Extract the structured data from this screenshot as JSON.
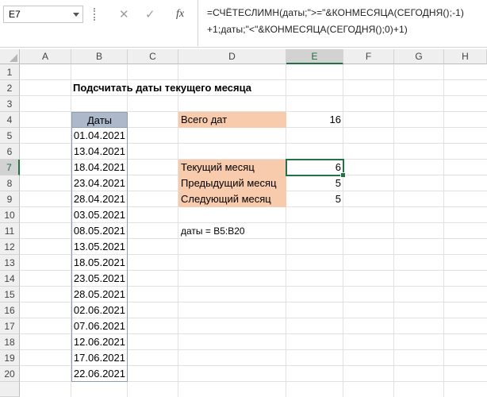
{
  "namebox": {
    "value": "E7"
  },
  "formula_bar": {
    "cancel_icon": "✕",
    "enter_icon": "✓",
    "fx_label": "fx",
    "formula": "=СЧЁТЕСЛИМН(даты;\">=\"&КОНМЕСЯЦА(СЕГОДНЯ();-1)\n+1;даты;\"<\"&КОНМЕСЯЦА(СЕГОДНЯ();0)+1)"
  },
  "columns": [
    "A",
    "B",
    "C",
    "D",
    "E",
    "F",
    "G",
    "H"
  ],
  "rows": [
    "1",
    "2",
    "3",
    "4",
    "5",
    "6",
    "7",
    "8",
    "9",
    "10",
    "11",
    "12",
    "13",
    "14",
    "15",
    "16",
    "17",
    "18",
    "19",
    "20"
  ],
  "selected": {
    "column": "E",
    "row": "7"
  },
  "sheet": {
    "title": "Подсчитать даты текущего месяца",
    "dates_header": "Даты",
    "dates": [
      "01.04.2021",
      "13.04.2021",
      "18.04.2021",
      "23.04.2021",
      "28.04.2021",
      "03.05.2021",
      "08.05.2021",
      "13.05.2021",
      "18.05.2021",
      "23.05.2021",
      "28.05.2021",
      "02.06.2021",
      "07.06.2021",
      "12.06.2021",
      "17.06.2021",
      "22.06.2021"
    ],
    "total_label": "Всего дат",
    "total_value": "16",
    "current_label": "Текущий месяц",
    "current_value": "6",
    "previous_label": "Предыдущий месяц",
    "previous_value": "5",
    "next_label": "Следующий месяц",
    "next_value": "5",
    "named_range_note": "даты = B5:B20"
  },
  "colors": {
    "accent": "#217346",
    "label_fill": "#f8cbad",
    "header_fill": "#acb9ca"
  }
}
